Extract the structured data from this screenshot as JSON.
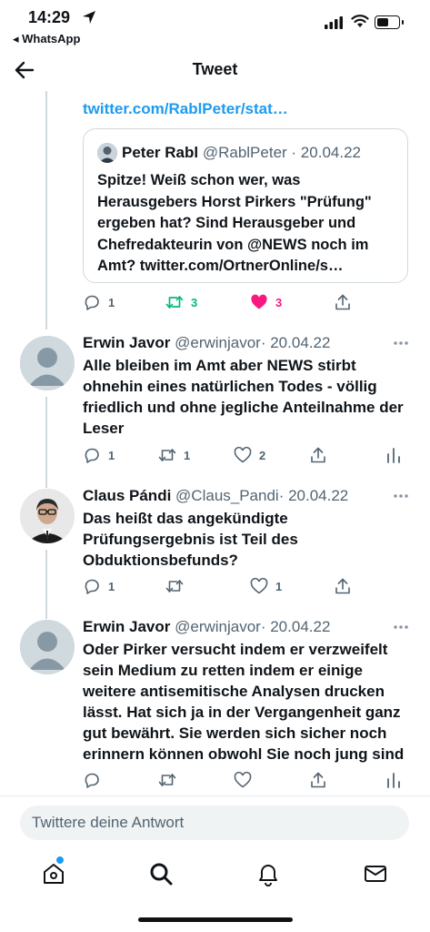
{
  "status_bar": {
    "time": "14:29",
    "back_app": "◂ WhatsApp"
  },
  "header": {
    "title": "Tweet"
  },
  "top_link": "twitter.com/RablPeter/stat…",
  "quoted_tweet": {
    "author_name": "Peter Rabl",
    "author_handle": "@RablPeter",
    "date": "· 20.04.22",
    "text": "Spitze! Weiß schon wer, was Herausgebers Horst Pirkers \"Prüfung\" ergeben hat? Sind Herausgeber und Chefredakteurin von @NEWS noch im Amt? twitter.com/OrtnerOnline/s…"
  },
  "parent_actions": {
    "replies": "1",
    "retweets": "3",
    "likes": "3",
    "retweet_color": "#00ba7c",
    "like_color": "#f91880"
  },
  "replies": [
    {
      "author_name": "Erwin Javor",
      "author_handle": "@erwinjavor",
      "date": "· 20.04.22",
      "text": "Alle bleiben im Amt aber NEWS stirbt ohnehin eines natürlichen Todes - völlig friedlich und ohne jegliche Anteilnahme der Leser",
      "replies": "1",
      "retweets": "1",
      "likes": "2"
    },
    {
      "author_name": "Claus Pándi",
      "author_handle": "@Claus_Pandi",
      "date": "· 20.04.22",
      "text": "Das heißt das angekündigte Prüfungsergebnis ist Teil des Obduktionsbefunds?",
      "replies": "1",
      "retweets": "",
      "likes": "1"
    },
    {
      "author_name": "Erwin Javor",
      "author_handle": "@erwinjavor",
      "date": "· 20.04.22",
      "text": "Oder Pirker versucht indem er verzweifelt sein Medium zu retten indem er einige weitere antisemitische Analysen drucken lässt. Hat sich ja in der Vergangenheit ganz gut bewährt. Sie werden sich sicher noch erinnern können obwohl Sie noch jung sind",
      "replies": "",
      "retweets": "",
      "likes": ""
    }
  ],
  "reply_box": {
    "placeholder": "Twittere deine Antwort"
  },
  "colors": {
    "accent": "#1d9bf0",
    "secondary_text": "#536471"
  }
}
